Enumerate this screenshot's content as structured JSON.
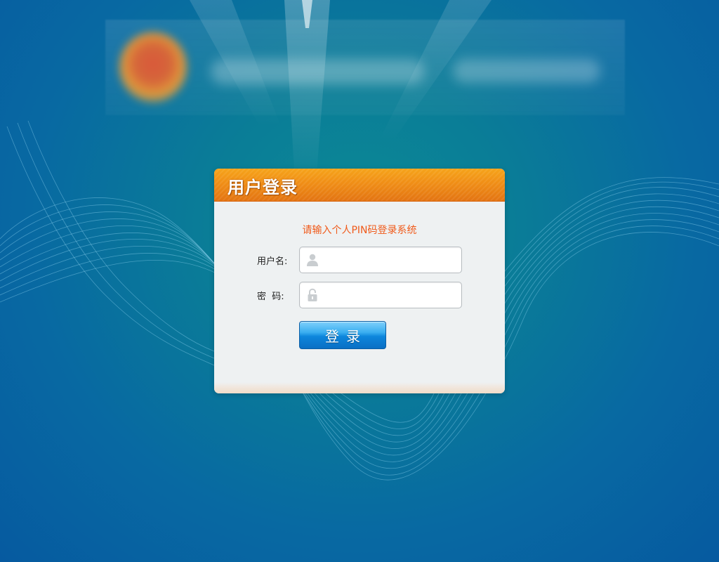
{
  "login": {
    "title": "用户登录",
    "hint": "请输入个人PIN码登录系统",
    "username_label": "用户名:",
    "password_label": "密  码:",
    "username_value": "",
    "password_value": "",
    "submit_label": "登录"
  },
  "icons": {
    "user": "user-icon",
    "lock": "lock-icon"
  },
  "colors": {
    "header_orange": "#f08e16",
    "hint_text": "#f05a1a",
    "button_blue": "#0d86dc",
    "background_teal": "#0a7d97"
  }
}
